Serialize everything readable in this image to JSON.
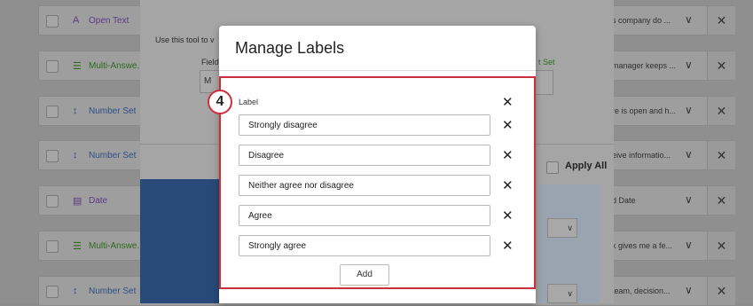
{
  "rows": [
    {
      "icon": "A",
      "type": "Open Text",
      "color": "purple",
      "snippet": "s company do ..."
    },
    {
      "icon": "☰",
      "type": "Multi-Answe...",
      "color": "green",
      "snippet": "manager keeps ..."
    },
    {
      "icon": "↕",
      "type": "Number Set",
      "color": "blue",
      "snippet": "re is open and h..."
    },
    {
      "icon": "↕",
      "type": "Number Set",
      "color": "blue",
      "snippet": "eive informatio..."
    },
    {
      "icon": "▤",
      "type": "Date",
      "color": "purple",
      "snippet": "d Date"
    },
    {
      "icon": "☰",
      "type": "Multi-Answe...",
      "color": "green",
      "snippet": "k gives me a fe..."
    },
    {
      "icon": "↕",
      "type": "Number Set",
      "color": "blue",
      "snippet": "team, decision..."
    }
  ],
  "panel": {
    "hint": "Use this tool to v",
    "field_label": "Field",
    "field_value": "M",
    "set_label": "t Set",
    "apply_all": "Apply All"
  },
  "modal": {
    "title": "Manage Labels",
    "column_label": "Label",
    "labels": [
      "Strongly disagree",
      "Disagree",
      "Neither agree nor disagree",
      "Agree",
      "Strongly agree"
    ],
    "add_label": "Add",
    "step_badge": "4"
  },
  "icons": {
    "remove": "✕",
    "chevron": "∨"
  },
  "colors": {
    "highlight": "#c8313c",
    "overlay": "#8f8f8f"
  }
}
